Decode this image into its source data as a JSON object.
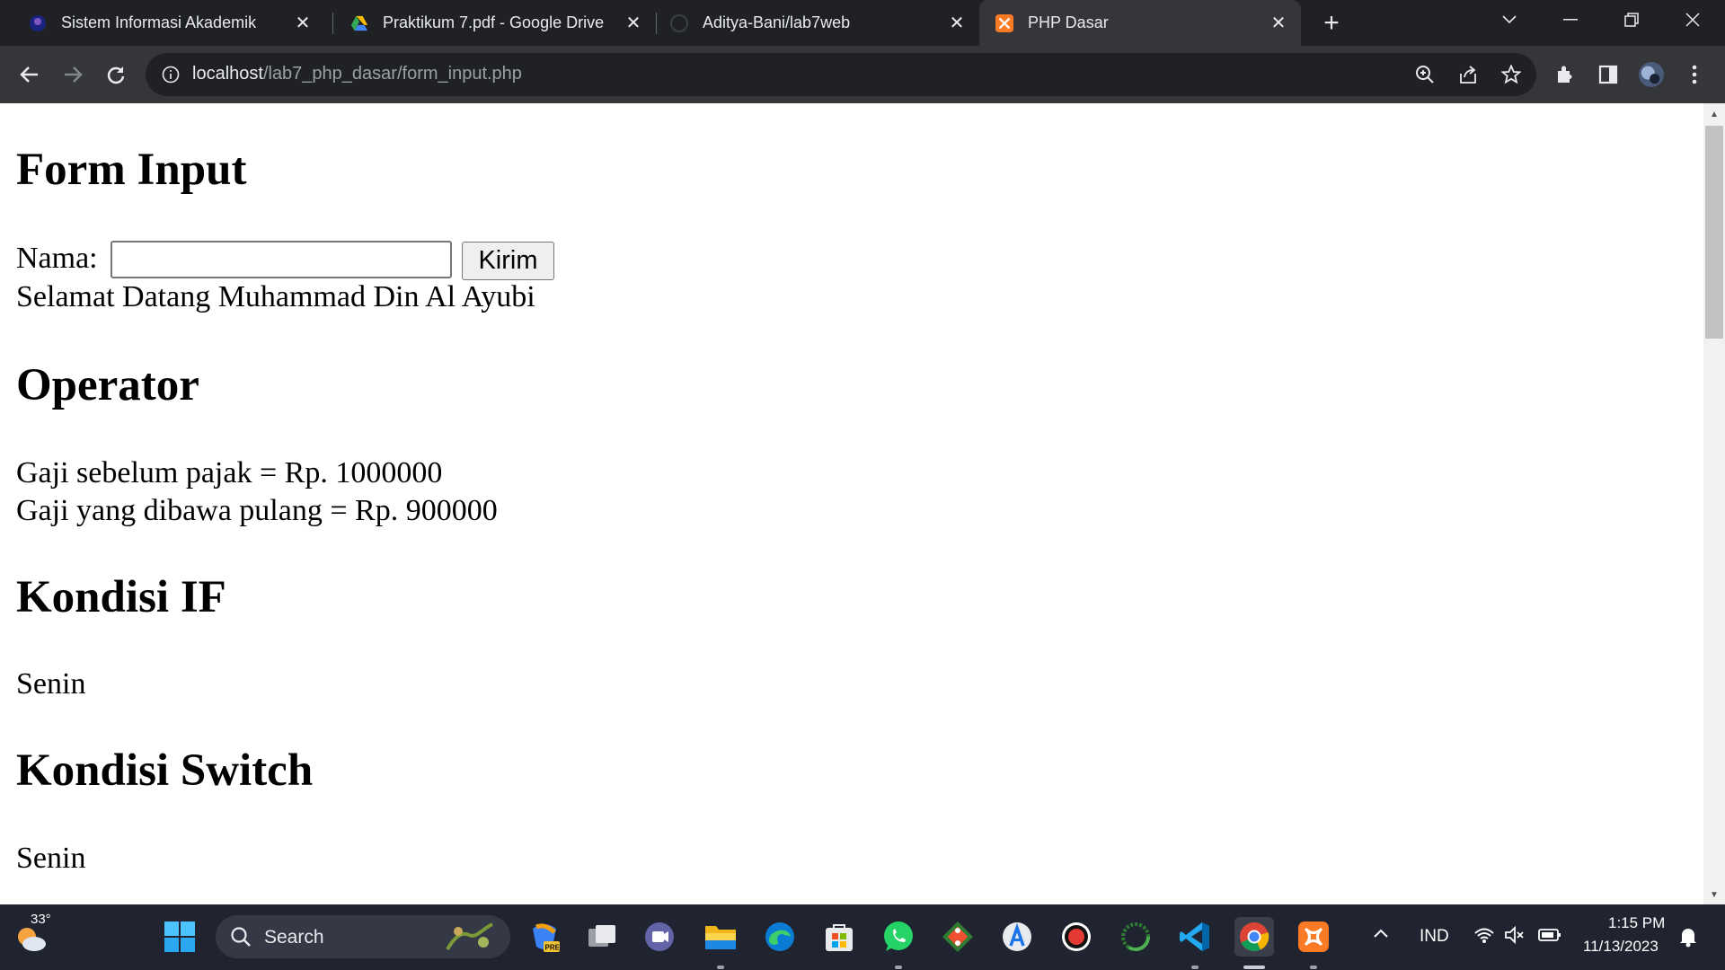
{
  "browser": {
    "tabs": [
      {
        "title": "Sistem Informasi Akademik",
        "favicon": "campus-logo-icon",
        "active": false
      },
      {
        "title": "Praktikum 7.pdf - Google Drive",
        "favicon": "google-drive-icon",
        "active": false
      },
      {
        "title": "Aditya-Bani/lab7web",
        "favicon": "github-icon",
        "active": false
      },
      {
        "title": "PHP Dasar",
        "favicon": "xampp-icon",
        "active": true
      }
    ],
    "url_host": "localhost",
    "url_path": "/lab7_php_dasar/form_input.php",
    "colors": {
      "tabstrip": "#202124",
      "toolbar": "#35363a",
      "omnibox": "#202124"
    }
  },
  "page": {
    "form_heading": "Form Input",
    "nama_label": "Nama:",
    "nama_value": "",
    "kirim_label": "Kirim",
    "welcome": "Selamat Datang Muhammad Din Al Ayubi",
    "operator_heading": "Operator",
    "gaji_sebelum": "Gaji sebelum pajak = Rp. 1000000",
    "gaji_dibawa": "Gaji yang dibawa pulang = Rp. 900000",
    "if_heading": "Kondisi IF",
    "if_result": "Senin",
    "switch_heading": "Kondisi Switch",
    "switch_result": "Senin"
  },
  "taskbar": {
    "weather_temp": "33°",
    "search_label": "Search",
    "apps": [
      "copilot-icon",
      "task-view-icon",
      "teams-chat-icon",
      "file-explorer-icon",
      "edge-icon",
      "microsoft-store-icon",
      "whatsapp-icon",
      "git-icon",
      "android-studio-icon",
      "obs-icon",
      "loader-icon",
      "vscode-icon",
      "chrome-icon",
      "xampp-icon"
    ],
    "language": "IND",
    "time": "1:15 PM",
    "date": "11/13/2023"
  }
}
